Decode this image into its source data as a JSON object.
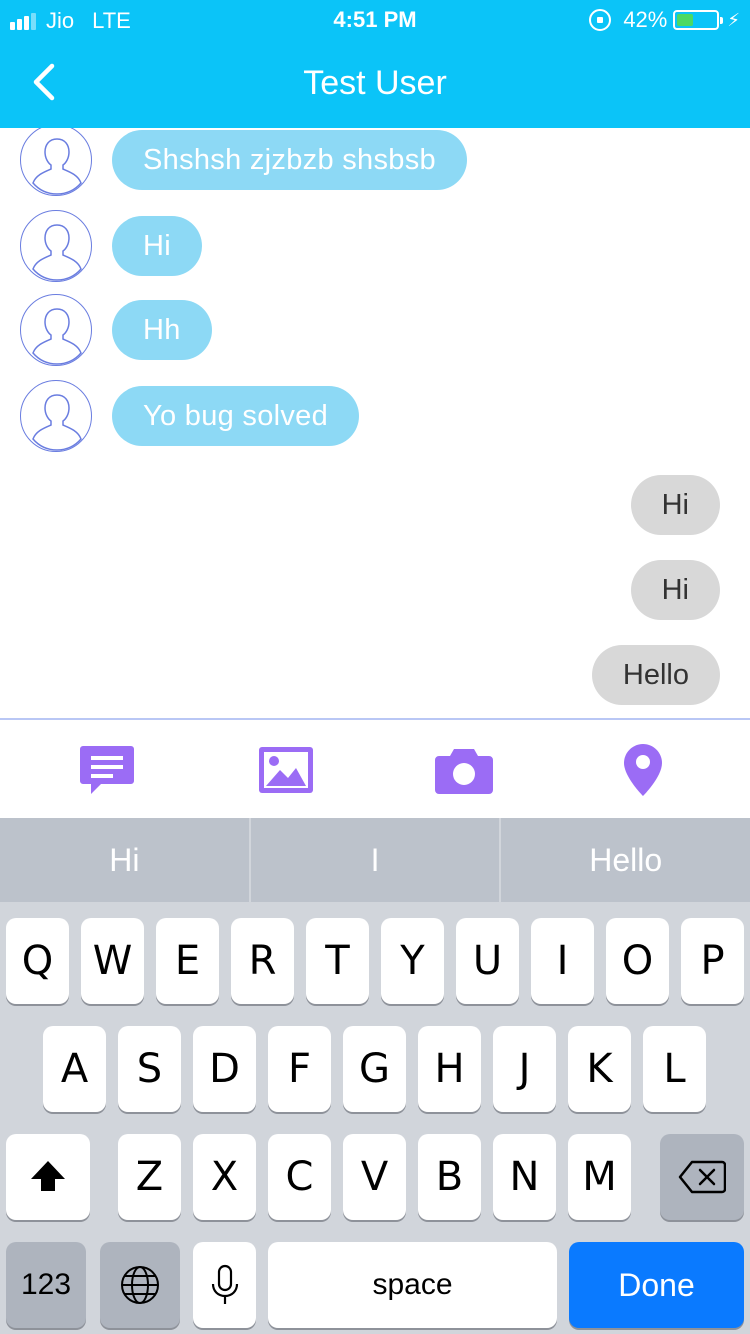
{
  "status_bar": {
    "carrier": "Jio",
    "network": "LTE",
    "time": "4:51 PM",
    "battery": "42%",
    "battery_level": 0.42
  },
  "nav": {
    "title": "Test User",
    "back_icon": "chevron-left-icon"
  },
  "messages": {
    "incoming": [
      {
        "text": "Shshsh zjzbzb shsbsb"
      },
      {
        "text": "Hi"
      },
      {
        "text": "Hh"
      },
      {
        "text": "Yo bug solved"
      }
    ],
    "outgoing": [
      {
        "text": "Hi"
      },
      {
        "text": "Hi"
      },
      {
        "text": "Hello"
      }
    ]
  },
  "toolbar": {
    "items": [
      {
        "icon": "chat-icon"
      },
      {
        "icon": "image-icon"
      },
      {
        "icon": "camera-icon"
      },
      {
        "icon": "location-pin-icon"
      }
    ],
    "accent": "#9B6CF5"
  },
  "predictive": [
    "Hi",
    "I",
    "Hello"
  ],
  "keyboard": {
    "row1": [
      "Q",
      "W",
      "E",
      "R",
      "T",
      "Y",
      "U",
      "I",
      "O",
      "P"
    ],
    "row2": [
      "A",
      "S",
      "D",
      "F",
      "G",
      "H",
      "J",
      "K",
      "L"
    ],
    "row3": [
      "Z",
      "X",
      "C",
      "V",
      "B",
      "N",
      "M"
    ],
    "numbers_label": "123",
    "space_label": "space",
    "done_label": "Done"
  },
  "colors": {
    "header": "#0BC4F8",
    "incoming_bubble": "#8DD9F5",
    "outgoing_bubble": "#D8D8D8",
    "done_key": "#0A7AFF"
  }
}
